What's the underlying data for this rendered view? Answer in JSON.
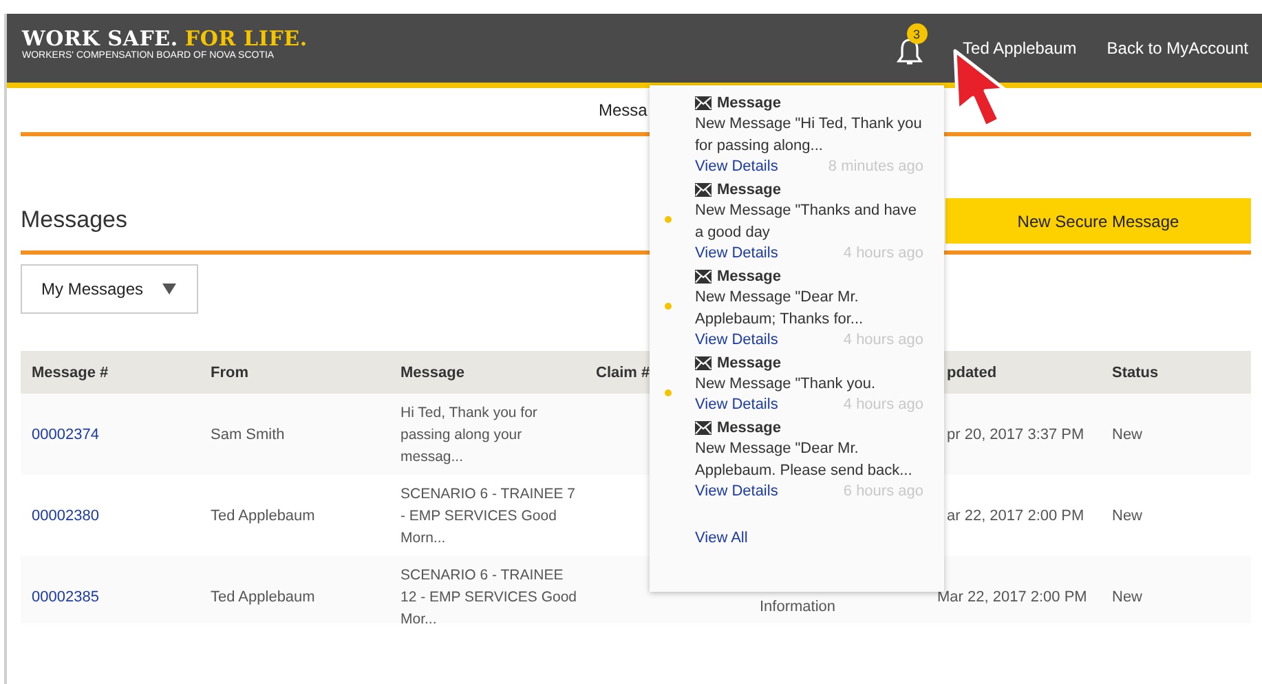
{
  "header": {
    "logo_main": "WORK SAFE.",
    "logo_accent": "FOR LIFE.",
    "logo_sub": "WORKERS' COMPENSATION BOARD OF NOVA SCOTIA",
    "badge": "3",
    "user": "Ted Applebaum",
    "back_link": "Back to MyAccount"
  },
  "nav": {
    "item": "Messa"
  },
  "page": {
    "title": "Messages",
    "new_button": "New Secure Message",
    "filter": "My Messages"
  },
  "table": {
    "columns": [
      "Message #",
      "From",
      "Message",
      "Claim #",
      "",
      "pdated",
      "Status"
    ],
    "rows": [
      {
        "number": "00002374",
        "from": "Sam Smith",
        "message": "Hi Ted, Thank you for passing along your messag...",
        "column_5": "",
        "updated": "pr 20, 2017 3:37 PM",
        "status": "New"
      },
      {
        "number": "00002380",
        "from": "Ted Applebaum",
        "message": "SCENARIO 6 - TRAINEE 7 - EMP SERVICES Good Morn...",
        "column_5": "",
        "updated": "ar 22, 2017 2:00 PM",
        "status": "New"
      },
      {
        "number": "00002385",
        "from": "Ted Applebaum",
        "message": "SCENARIO 6 - TRAINEE 12 - EMP SERVICES Good Mor...",
        "column_5": "Information",
        "updated": "Mar 22, 2017 2:00 PM",
        "status": "New"
      }
    ]
  },
  "notifications": {
    "items": [
      {
        "title": "Message",
        "text": "New Message \"Hi Ted, Thank you for passing along...",
        "link": "View Details",
        "time": "8 minutes ago",
        "unread": false
      },
      {
        "title": "Message",
        "text": "New Message \"Thanks and have a good day",
        "link": "View Details",
        "time": "4 hours ago",
        "unread": true
      },
      {
        "title": "Message",
        "text": "New Message \"Dear Mr. Applebaum; Thanks for...",
        "link": "View Details",
        "time": "4 hours ago",
        "unread": true
      },
      {
        "title": "Message",
        "text": "New Message \"Thank you.",
        "link": "View Details",
        "time": "4 hours ago",
        "unread": true
      },
      {
        "title": "Message",
        "text": "New Message \"Dear Mr. Applebaum. Please send back...",
        "link": "View Details",
        "time": "6 hours ago",
        "unread": false
      }
    ],
    "view_all": "View All"
  }
}
